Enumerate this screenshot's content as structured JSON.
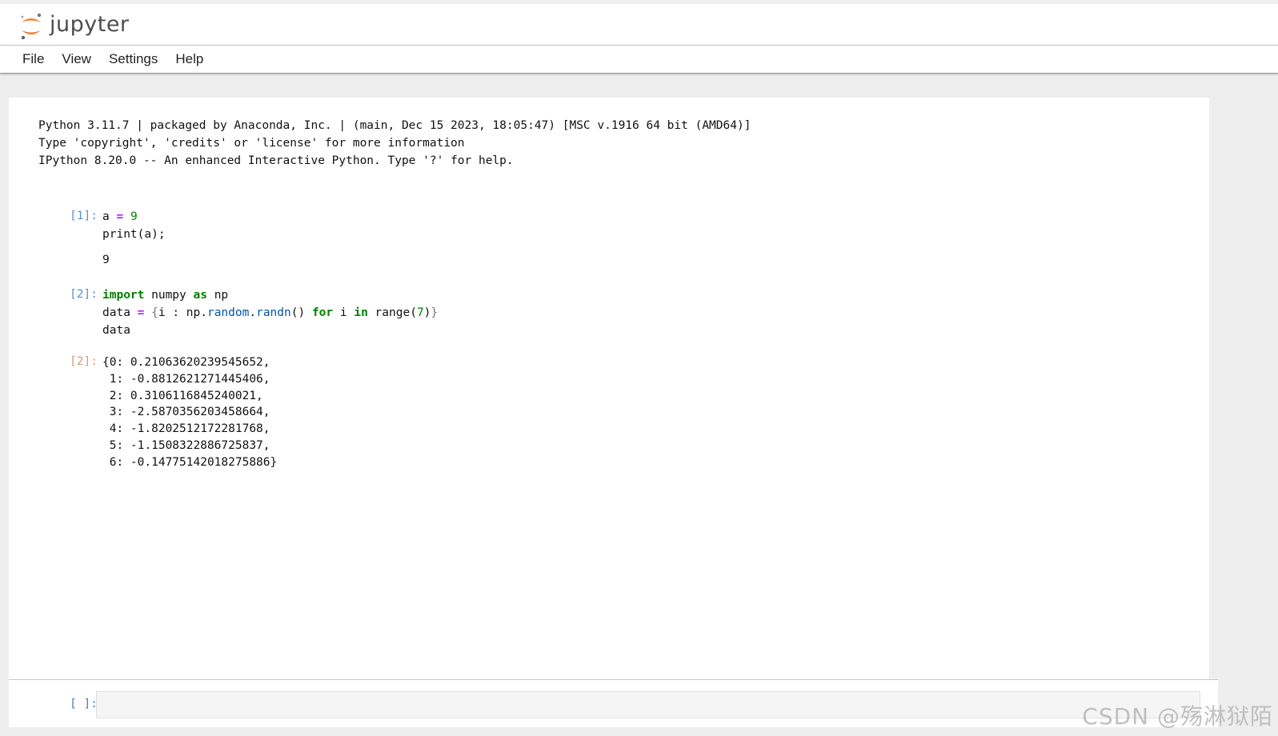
{
  "app": {
    "logo_text": "jupyter"
  },
  "menu": [
    "File",
    "View",
    "Settings",
    "Help"
  ],
  "banner": [
    "Python 3.11.7 | packaged by Anaconda, Inc. | (main, Dec 15 2023, 18:05:47) [MSC v.1916 64 bit (AMD64)]",
    "Type 'copyright', 'credits' or 'license' for more information",
    "IPython 8.20.0 -- An enhanced Interactive Python. Type '?' for help."
  ],
  "cells": {
    "c1": {
      "prompt": "[1]:",
      "output": "9"
    },
    "c2": {
      "prompt": "[2]:"
    },
    "out2": {
      "prompt": "[2]:",
      "lines": [
        "{0: 0.21063620239545652,",
        " 1: -0.8812621271445406,",
        " 2: 0.3106116845240021,",
        " 3: -2.5870356203458664,",
        " 4: -1.8202512172281768,",
        " 5: -1.1508322886725837,",
        " 6: -0.14775142018275886}"
      ]
    }
  },
  "input": {
    "prompt": "[ ]:"
  },
  "watermark": "CSDN @殇淋狱陌",
  "colors": {
    "keyword": "#008000",
    "operator": "#aa22ff",
    "in_prompt": "#5c8fc7",
    "out_prompt": "#d49a7a",
    "logo_orange": "#f37726"
  }
}
